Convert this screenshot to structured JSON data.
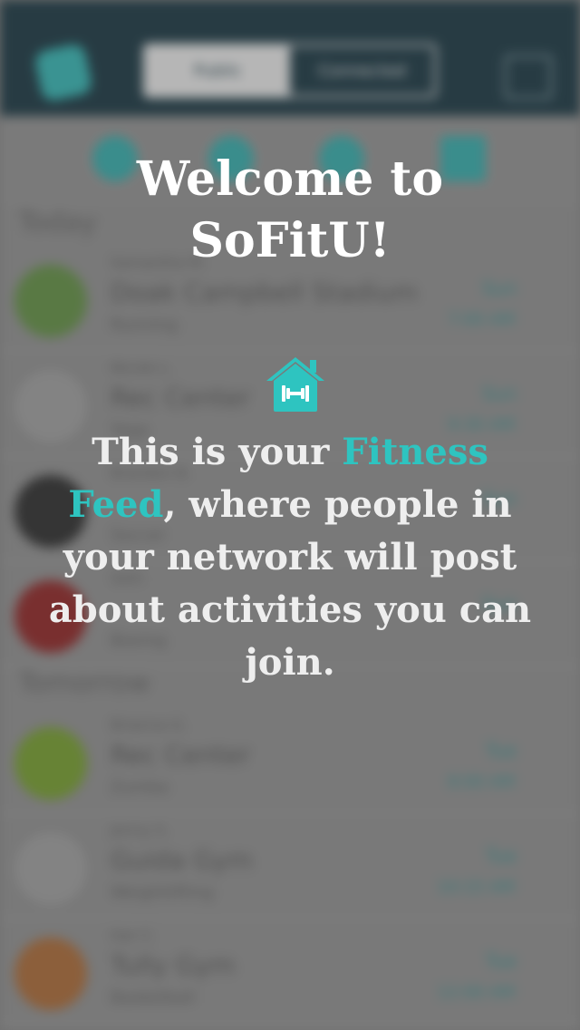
{
  "background_app": {
    "tabs": [
      "Public",
      "Connected"
    ],
    "sections": [
      {
        "title": "Today",
        "rows": [
          {
            "name": "Samantha M.",
            "place": "Doak Campbell Stadium",
            "activity": "Running",
            "day": "Sun",
            "time": "7:00 AM",
            "avatar_color": "#5a8a3a"
          },
          {
            "name": "Nicole L.",
            "place": "Rec Center",
            "activity": "Yoga",
            "day": "Sun",
            "time": "9:30 AM",
            "avatar_color": "#9a9a9a"
          },
          {
            "name": "Brandon B.",
            "place": "",
            "activity": "Soccer",
            "day": "Sun",
            "time": "",
            "avatar_color": "#222222"
          },
          {
            "name": "Seth",
            "place": "",
            "activity": "Boxing",
            "day": "Sun",
            "time": "",
            "avatar_color": "#8b1a1a"
          }
        ]
      },
      {
        "title": "Tomorrow",
        "rows": [
          {
            "name": "Brianna G.",
            "place": "Rec Center",
            "activity": "Zumba",
            "day": "Tue",
            "time": "8:00 AM",
            "avatar_color": "#6f9a23"
          },
          {
            "name": "Jenny S.",
            "place": "Guida Gym",
            "activity": "Weightlifting",
            "day": "Tue",
            "time": "10:15 AM",
            "avatar_color": "#9a9a9a"
          },
          {
            "name": "Gar C.",
            "place": "Tully Gym",
            "activity": "Basketball",
            "day": "Tue",
            "time": "12:00 AM",
            "avatar_color": "#a8632c"
          }
        ]
      }
    ]
  },
  "overlay": {
    "welcome_line1": "Welcome to",
    "welcome_line2": "SoFitU!",
    "text_before": "This is your ",
    "highlight": "Fitness Feed",
    "text_after": ", where people in your network will post about activities you can join.",
    "icon": "home-dumbbell-icon",
    "accent_color": "#2ec4c0"
  }
}
